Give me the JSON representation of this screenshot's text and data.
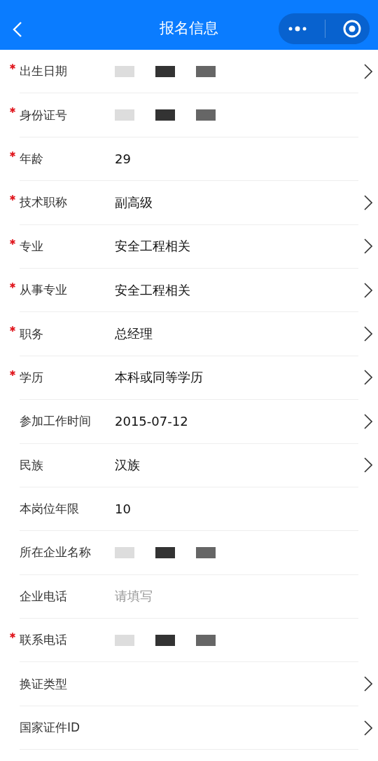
{
  "nav": {
    "title": "报名信息"
  },
  "fields": [
    {
      "label": "出生日期",
      "required": true,
      "redacted": true,
      "arrow": true
    },
    {
      "label": "身份证号",
      "required": true,
      "redacted": true,
      "arrow": false
    },
    {
      "label": "年龄",
      "required": true,
      "value": "29",
      "arrow": false
    },
    {
      "label": "技术职称",
      "required": true,
      "value": "副高级",
      "arrow": true
    },
    {
      "label": "专业",
      "required": true,
      "value": "安全工程相关",
      "arrow": true
    },
    {
      "label": "从事专业",
      "required": true,
      "value": "安全工程相关",
      "arrow": true
    },
    {
      "label": "职务",
      "required": true,
      "value": "总经理",
      "arrow": true
    },
    {
      "label": "学历",
      "required": true,
      "value": "本科或同等学历",
      "arrow": true
    },
    {
      "label": "参加工作时间",
      "required": false,
      "value": "2015-07-12",
      "arrow": true
    },
    {
      "label": "民族",
      "required": false,
      "value": "汉族",
      "arrow": true
    },
    {
      "label": "本岗位年限",
      "required": false,
      "value": "10",
      "arrow": false
    },
    {
      "label": "所在企业名称",
      "required": false,
      "redacted": true,
      "arrow": false
    },
    {
      "label": "企业电话",
      "required": false,
      "placeholder": "请填写",
      "arrow": false
    },
    {
      "label": "联系电话",
      "required": true,
      "redacted": true,
      "arrow": false
    },
    {
      "label": "换证类型",
      "required": false,
      "arrow": true
    },
    {
      "label": "国家证件ID",
      "required": false,
      "arrow": true
    }
  ]
}
